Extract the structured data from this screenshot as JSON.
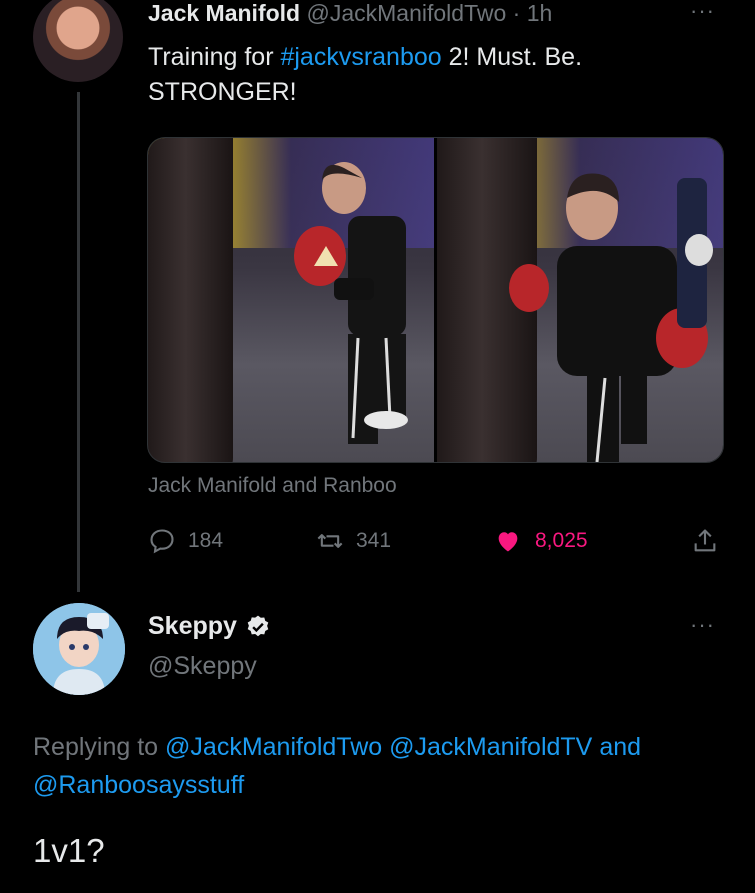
{
  "tweet1": {
    "author_name": "Jack Manifold",
    "handle": "@JackManifoldTwo",
    "separator": "·",
    "time": "1h",
    "text_part1": "Training for ",
    "hashtag": "#jackvsranboo",
    "text_part2": " 2! Must. Be. STRONGER!",
    "tagged": "Jack Manifold and Ranboo",
    "more_label": "···",
    "replies": "184",
    "retweets": "341",
    "likes": "8,025"
  },
  "tweet2": {
    "author_name": "Skeppy",
    "handle": "@Skeppy",
    "more_label": "···",
    "replying_prefix": "Replying to",
    "mention1": "@JackManifoldTwo",
    "mention2": "@JackManifoldTV",
    "and_word": "and",
    "mention3": "@Ranboosaysstuff",
    "text": "1v1?"
  },
  "colors": {
    "background": "#000000",
    "text": "#e7e9ea",
    "muted": "#71767b",
    "link": "#1d9bf0",
    "like": "#f91880"
  },
  "icons": [
    "reply-icon",
    "retweet-icon",
    "heart-icon",
    "share-icon",
    "verified-badge-icon",
    "more-icon"
  ]
}
